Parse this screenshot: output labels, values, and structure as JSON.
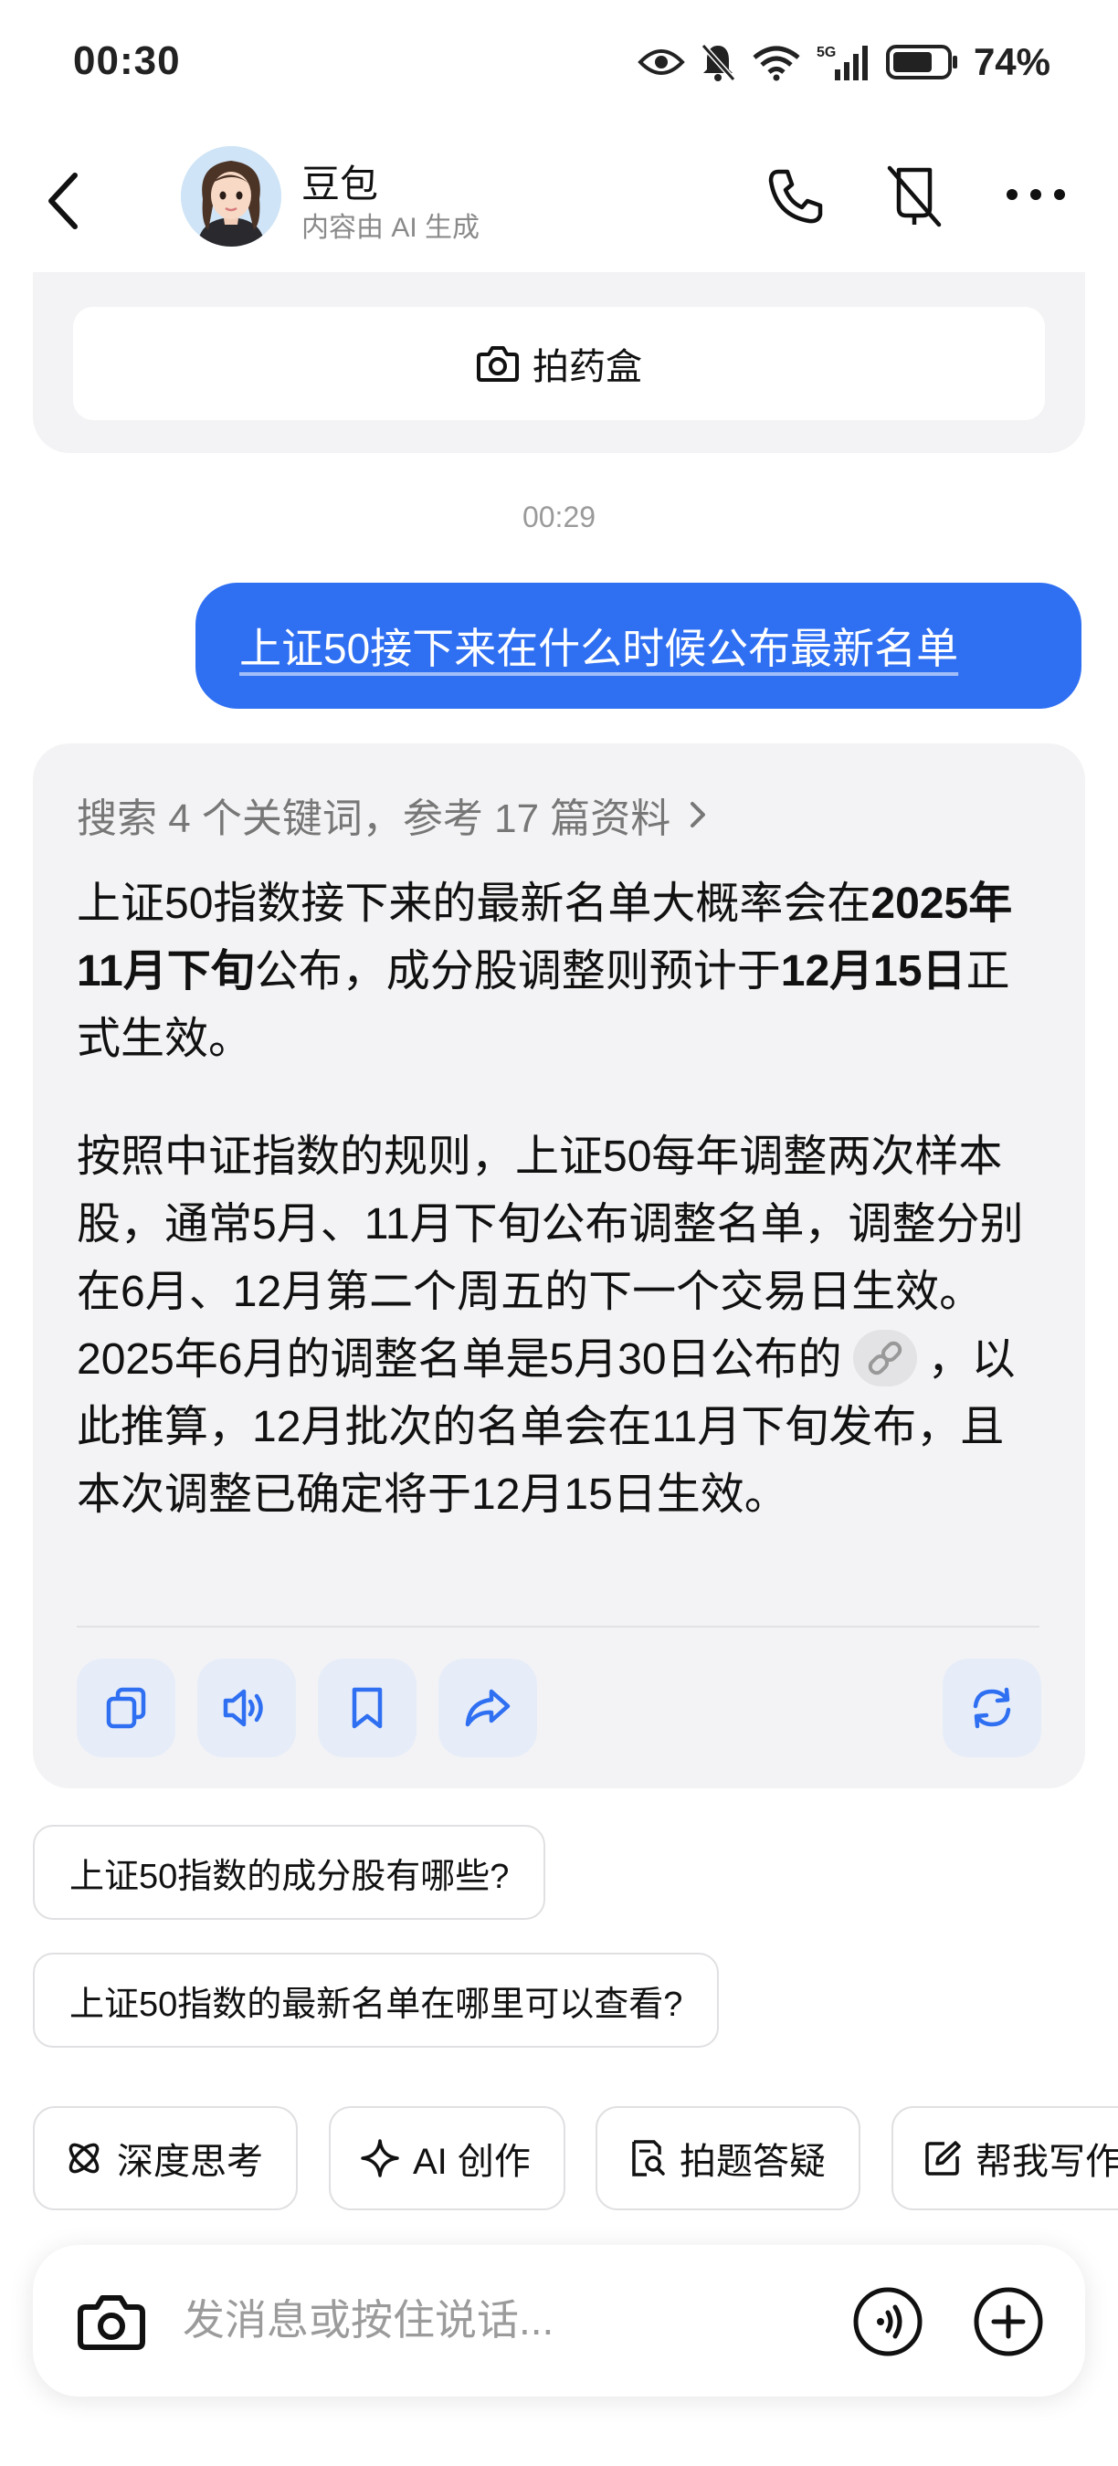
{
  "status_bar": {
    "time": "00:30",
    "battery": "74%"
  },
  "header": {
    "name": "豆包",
    "subtitle": "内容由 AI 生成"
  },
  "previous_card": {
    "button_label": "拍药盒"
  },
  "timestamp": "00:29",
  "user_message": "上证50接下来在什么时候公布最新名单",
  "answer": {
    "search_summary": "搜索 4 个关键词，参考 17 篇资料",
    "p1": {
      "t1": "上证50指数接下来的最新名单大概率会在",
      "b1": "2025年11月下旬",
      "t2": "公布，成分股调整则预计于",
      "b2": "12月15日",
      "t3": "正式生效。"
    },
    "p2": {
      "t1": "按照中证指数的规则，上证50每年调整两次样本股，通常5月、11月下旬公布调整名单，调整分别在6月、12月第二个周五的下一个交易日生效。2025年6月的调整名单是5月30日公布的",
      "t2": "，以此推算，12月批次的名单会在11月下旬发布，且本次调整已确定将于12月15日生效。"
    }
  },
  "suggestions": [
    "上证50指数的成分股有哪些?",
    "上证50指数的最新名单在哪里可以查看?"
  ],
  "tools": [
    "深度思考",
    "AI 创作",
    "拍题答疑",
    "帮我写作"
  ],
  "input": {
    "placeholder": "发消息或按住说话..."
  },
  "colors": {
    "accent": "#2f6ff2",
    "card_bg": "#f3f3f5",
    "action_bg": "#e7edf8",
    "action_icon": "#2f6ff2"
  }
}
